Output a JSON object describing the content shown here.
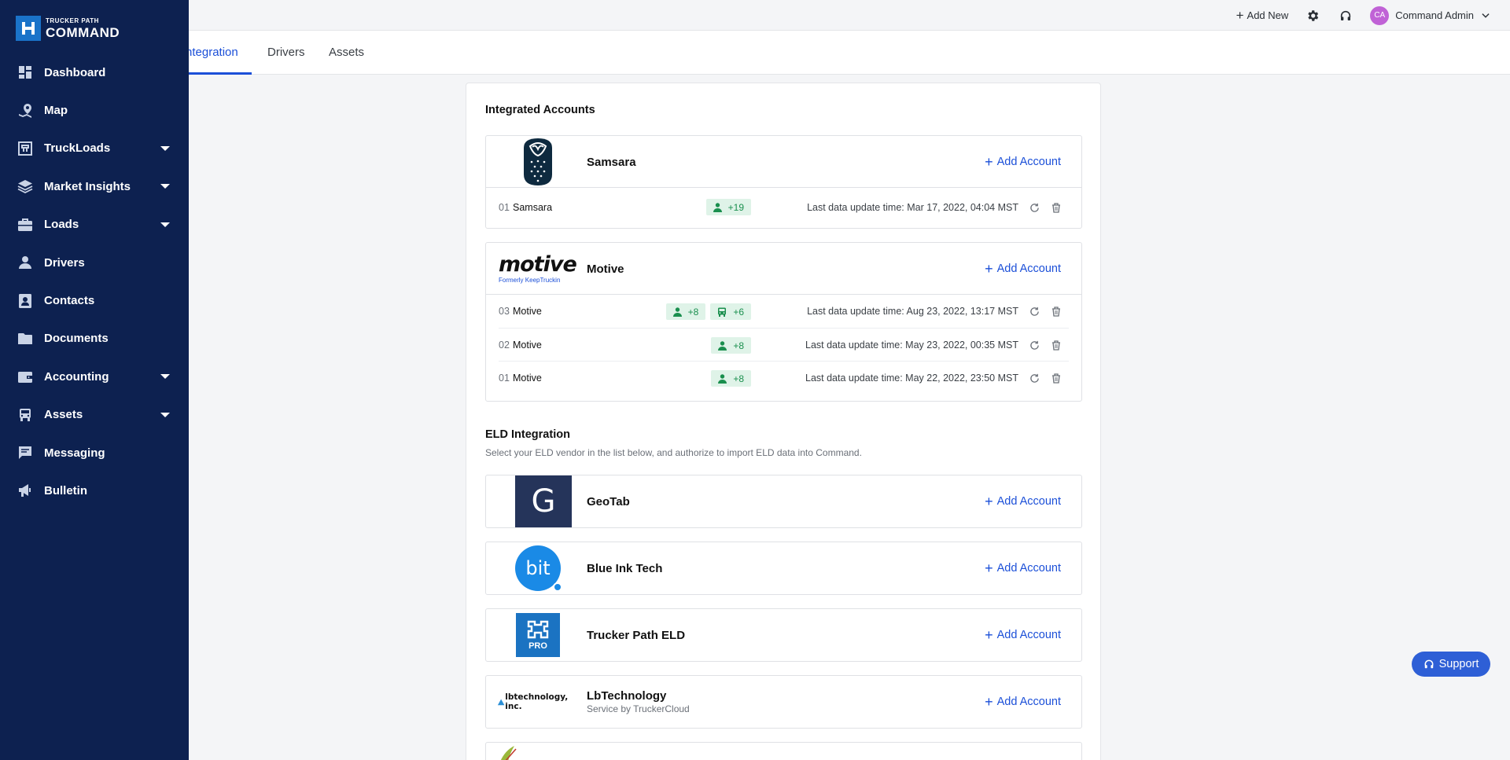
{
  "topbar": {
    "add_new_label": "Add New",
    "user_initials": "CA",
    "user_name": "Command Admin"
  },
  "tabs": [
    {
      "label": "ntegration",
      "active": true
    },
    {
      "label": "Drivers",
      "active": false
    },
    {
      "label": "Assets",
      "active": false
    }
  ],
  "sidebar": {
    "logo_small": "TRUCKER PATH",
    "logo_big": "COMMAND",
    "items": [
      {
        "label": "Dashboard",
        "icon": "dashboard-icon",
        "has_caret": false
      },
      {
        "label": "Map",
        "icon": "map-pin-icon",
        "has_caret": false
      },
      {
        "label": "TruckLoads",
        "icon": "truckloads-icon",
        "has_caret": true
      },
      {
        "label": "Market Insights",
        "icon": "layers-icon",
        "has_caret": true
      },
      {
        "label": "Loads",
        "icon": "briefcase-icon",
        "has_caret": true
      },
      {
        "label": "Drivers",
        "icon": "driver-icon",
        "has_caret": false
      },
      {
        "label": "Contacts",
        "icon": "contacts-icon",
        "has_caret": false
      },
      {
        "label": "Documents",
        "icon": "folder-icon",
        "has_caret": false
      },
      {
        "label": "Accounting",
        "icon": "wallet-icon",
        "has_caret": true
      },
      {
        "label": "Assets",
        "icon": "truck-icon",
        "has_caret": true
      },
      {
        "label": "Messaging",
        "icon": "message-icon",
        "has_caret": false
      },
      {
        "label": "Bulletin",
        "icon": "megaphone-icon",
        "has_caret": false
      }
    ]
  },
  "integrated": {
    "title": "Integrated Accounts",
    "add_label": "Add Account",
    "samsara": {
      "name": "Samsara",
      "accounts": [
        {
          "num": "01",
          "name": "Samsara",
          "drivers": "+19",
          "vehicles": "",
          "time": "Last data update time: Mar 17, 2022, 04:04 MST"
        }
      ]
    },
    "motive": {
      "name": "Motive",
      "logo_word": "motive",
      "logo_sub": "Formerly KeepTruckin",
      "accounts": [
        {
          "num": "03",
          "name": "Motive",
          "drivers": "+8",
          "vehicles": "+6",
          "time": "Last data update time: Aug 23, 2022, 13:17 MST"
        },
        {
          "num": "02",
          "name": "Motive",
          "drivers": "+8",
          "vehicles": "",
          "time": "Last data update time: May 23, 2022, 00:35 MST"
        },
        {
          "num": "01",
          "name": "Motive",
          "drivers": "+8",
          "vehicles": "",
          "time": "Last data update time: May 22, 2022, 23:50 MST"
        }
      ]
    }
  },
  "eld": {
    "title": "ELD Integration",
    "subtitle": "Select your ELD vendor in the list below, and authorize to import ELD data into Command.",
    "vendors": [
      {
        "name": "GeoTab",
        "sub": "",
        "logo_text": "G"
      },
      {
        "name": "Blue Ink Tech",
        "sub": "",
        "logo_text": "bit"
      },
      {
        "name": "Trucker Path ELD",
        "sub": "",
        "logo_text": "PRO"
      },
      {
        "name": "LbTechnology",
        "sub": "Service by TruckerCloud",
        "logo_text": "lbtechnology, inc."
      }
    ]
  },
  "support_label": "Support",
  "colors": {
    "sidebar_bg": "#0d2150",
    "accent": "#1b4fd8",
    "badge_bg": "#dff3e8",
    "badge_fg": "#1a8f4e"
  }
}
